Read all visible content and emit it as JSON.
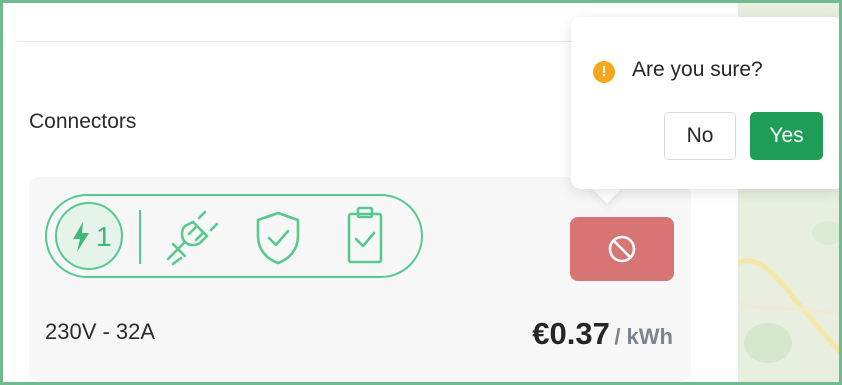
{
  "section": {
    "title": "Connectors"
  },
  "connector": {
    "number": "1",
    "voltage": "230V - 32A",
    "price": "€0.37",
    "price_unit": "/ kWh",
    "icons": [
      "lightning-icon",
      "plug-icon",
      "shield-check-icon",
      "clipboard-check-icon"
    ],
    "disable_icon": "ban-icon"
  },
  "popconfirm": {
    "title": "Are you sure?",
    "warning_glyph": "!",
    "no_label": "No",
    "yes_label": "Yes"
  },
  "colors": {
    "accent_green": "#58c98e",
    "yes_button": "#1e9e56",
    "danger_button": "#d77474",
    "warning": "#f5a61a"
  }
}
